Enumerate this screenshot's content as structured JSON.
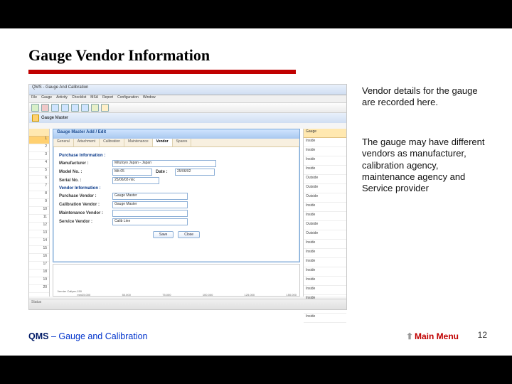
{
  "slide": {
    "title": "Gauge Vendor Information",
    "side1": "Vendor details for the gauge are recorded here.",
    "side2": "The gauge may have different vendors as manufacturer, calibration agency, maintenance agency and Service provider",
    "footer_prefix": "QMS",
    "footer_rest": " – Gauge and Calibration",
    "main_menu": "Main Menu",
    "page": "12"
  },
  "app": {
    "window_title": "QMS - Gauge And Calibration",
    "menu": [
      "File",
      "Gauge",
      "Activity",
      "Checklist",
      "MSA",
      "Report",
      "Configuration",
      "Window"
    ],
    "subheader": "Gauge Master",
    "status": "Status",
    "left": {
      "sel": "1",
      "rows": [
        "2",
        "3",
        "4",
        "5",
        "6",
        "7",
        "8",
        "9",
        "10",
        "11",
        "12",
        "13",
        "14",
        "15",
        "16",
        "17",
        "18",
        "19",
        "20"
      ]
    },
    "right": {
      "header": "Gauge",
      "rows": [
        "Inside",
        "Inside",
        "Inside",
        "Inside",
        "Outside",
        "Outside",
        "Outside",
        "Inside",
        "Inside",
        "Outside",
        "Outside",
        "Inside",
        "Inside",
        "Inside",
        "Inside",
        "Inside",
        "Inside",
        "Inside",
        "Inside",
        "Inside"
      ]
    },
    "popup": {
      "title": "Gauge Master Add / Edit",
      "tabs": [
        "General",
        "Attachment",
        "Calibration",
        "Maintenance",
        "Vendor",
        "Spares"
      ],
      "section1": "Purchase Information :",
      "manufacturer_lbl": "Manufacturer :",
      "manufacturer_val": "Mitutoyo Japan - Japan",
      "model_lbl": "Model No. :",
      "model_val": "Mit-05",
      "date_lbl": "Date :",
      "date_val": "25/06/02",
      "serial_lbl": "Serial No. :",
      "serial_val": "25/06/02-mic",
      "section2": "Vendor Information :",
      "purchase_lbl": "Purchase Vendor :",
      "purchase_val": "Gauge Master",
      "calib_lbl": "Calibration Vendor :",
      "calib_val": "Gauge Master",
      "maint_lbl": "Maintenance Vendor :",
      "maint_val": "",
      "service_lbl": "Service Vendor :",
      "service_val": "Calib Line",
      "save_btn": "Save",
      "close_btn": "Close"
    }
  },
  "chart_data": {
    "type": "line",
    "xlabel": "Vernier Caliper-150 mm",
    "x_ticks": [
      "25.000",
      "50.000",
      "75.000",
      "100.000",
      "125.000",
      "150.000"
    ],
    "series": [
      {
        "name": "",
        "values": []
      }
    ],
    "ylim": [
      0,
      1
    ]
  }
}
